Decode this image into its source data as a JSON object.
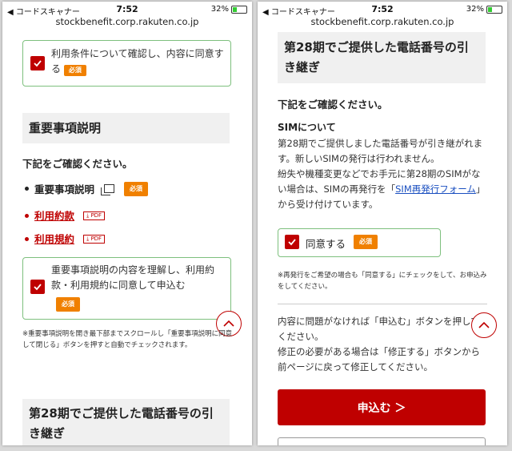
{
  "status_bar": {
    "carrier": "◀ コードスキャナー",
    "time": "7:52",
    "battery": "32%",
    "battery_level": 0.32
  },
  "url": "stockbenefit.corp.rakuten.co.jp",
  "left": {
    "terms_agree_text": "利用条件について確認し、内容に同意する",
    "required_label": "必須",
    "important_heading": "重要事項説明",
    "confirm_prompt": "下記をご確認ください。",
    "bullet_important": "重要事項説明",
    "bullet_terms_use": "利用約款",
    "bullet_terms_rules": "利用規約",
    "pdf_label": "PDF",
    "understand_agree_text": "重要事項説明の内容を理解し、利用約款・利用規約に同意して申込む",
    "note_text": "※重要事項説明を開き最下部までスクロールし「重要事項説明に同意して閉じる」ボタンを押すと自動でチェックされます。",
    "number_transfer_heading": "第28期でご提供した電話番号の引き継ぎ"
  },
  "right": {
    "number_transfer_heading": "第28期でご提供した電話番号の引き継ぎ",
    "confirm_prompt": "下記をご確認ください。",
    "sim_title": "SIMについて",
    "sim_text_1": "第28期でご提供しました電話番号が引き継がれます。新しいSIMの発行は行われません。",
    "sim_text_2_pre": "紛失や機種変更などでお手元に第28期のSIMがない場合は、SIMの再発行を「",
    "sim_link": "SIM再発行フォーム",
    "sim_text_2_post": "」から受け付けています。",
    "agree_label": "同意する",
    "required_label": "必須",
    "reissue_note": "※再発行をご希望の場合も「同意する」にチェックをして、お申込みをしてください。",
    "confirm_text_1": "内容に問題がなければ「申込む」ボタンを押してください。",
    "confirm_text_2": "修正の必要がある場合は「修正する」ボタンから前ページに戻って修正してください。",
    "apply_button": "申込む ＞"
  }
}
